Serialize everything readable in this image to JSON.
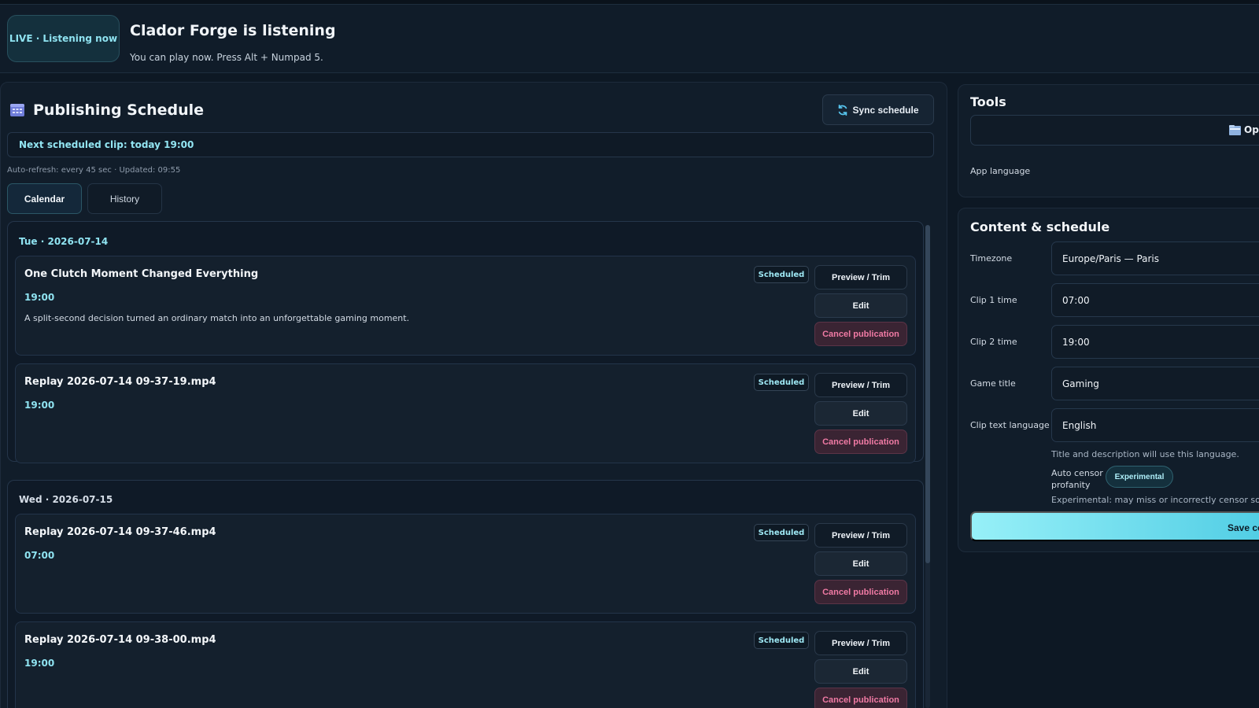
{
  "header": {
    "live_badge": "LIVE · Listening now",
    "title": "Clador Forge is listening",
    "subtitle": "You can play now. Press Alt + Numpad 5."
  },
  "schedule": {
    "icon": "calendar-icon",
    "title": "Publishing Schedule",
    "sync_label": "Sync schedule",
    "sync_icon": "refresh-icon",
    "next_clip": "Next scheduled clip: today 19:00",
    "refresh_info": "Auto-refresh: every 45 sec · Updated: 09:55",
    "tabs": [
      {
        "label": "Calendar",
        "active": true
      },
      {
        "label": "History",
        "active": false
      }
    ],
    "days": [
      {
        "label": "Tue · 2026-07-14",
        "clips": [
          {
            "title": "One Clutch Moment Changed Everything",
            "time": "19:00",
            "description": "A split-second decision turned an ordinary match into an unforgettable gaming moment.",
            "status": "Scheduled"
          },
          {
            "title": "Replay 2026-07-14 09-37-19.mp4",
            "time": "19:00",
            "description": "",
            "status": "Scheduled"
          }
        ]
      },
      {
        "label": "Wed · 2026-07-15",
        "clips": [
          {
            "title": "Replay 2026-07-14 09-37-46.mp4",
            "time": "07:00",
            "description": "",
            "status": "Scheduled"
          },
          {
            "title": "Replay 2026-07-14 09-38-00.mp4",
            "time": "19:00",
            "description": "",
            "status": "Scheduled"
          }
        ]
      }
    ],
    "actions": {
      "preview": "Preview / Trim",
      "edit": "Edit",
      "cancel": "Cancel publication"
    }
  },
  "tools": {
    "title": "Tools",
    "open_button": "Ope",
    "open_icon": "folder-icon",
    "app_language_label": "App language"
  },
  "content": {
    "title": "Content & schedule",
    "fields": [
      {
        "label": "Timezone",
        "value": "Europe/Paris — Paris"
      },
      {
        "label": "Clip 1 time",
        "value": "07:00"
      },
      {
        "label": "Clip 2 time",
        "value": "19:00"
      },
      {
        "label": "Game title",
        "value": "Gaming"
      },
      {
        "label": "Clip text language",
        "value": "English"
      }
    ],
    "language_hint": "Title and description will use this language.",
    "auto_censor_label": "Auto censor profanity",
    "experimental_badge": "Experimental",
    "experimental_note": "Experimental: may miss or incorrectly censor some w",
    "save_label": "Save co"
  },
  "colors": {
    "background": "#0d1824",
    "accent": "#8fe3f1",
    "danger": "#f07aa4"
  }
}
